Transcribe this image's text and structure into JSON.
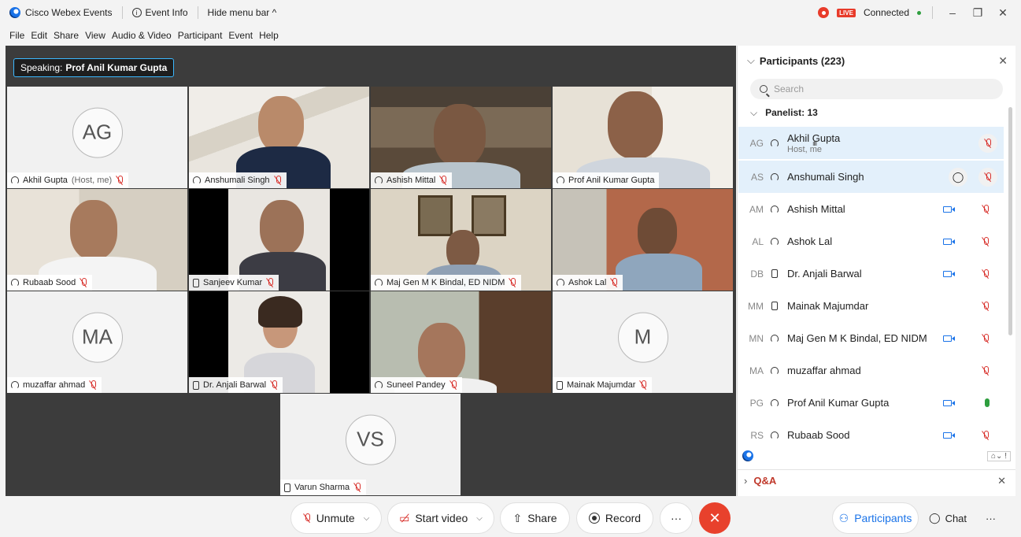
{
  "titlebar": {
    "app_name": "Cisco Webex Events",
    "event_info": "Event Info",
    "hide_menu": "Hide menu bar ^",
    "live": "LIVE",
    "connected": "Connected"
  },
  "menu": [
    "File",
    "Edit",
    "Share",
    "View",
    "Audio & Video",
    "Participant",
    "Event",
    "Help"
  ],
  "speaking": {
    "prefix": "Speaking:",
    "name": "Prof Anil Kumar Gupta"
  },
  "tiles": [
    {
      "name": "Akhil Gupta",
      "sub": "(Host, me)",
      "initials": "AG"
    },
    {
      "name": "Anshumali Singh"
    },
    {
      "name": "Ashish Mittal"
    },
    {
      "name": "Prof Anil Kumar Gupta"
    },
    {
      "name": "Rubaab Sood"
    },
    {
      "name": "Sanjeev Kumar"
    },
    {
      "name": "Maj Gen M K Bindal, ED NIDM"
    },
    {
      "name": "Ashok Lal"
    },
    {
      "name": "muzaffar ahmad",
      "initials": "MA"
    },
    {
      "name": "Dr. Anjali Barwal"
    },
    {
      "name": "Suneel Pandey"
    },
    {
      "name": "Mainak Majumdar",
      "initials": "M"
    },
    {
      "name": "Varun Sharma",
      "initials": "VS"
    }
  ],
  "controls": {
    "unmute": "Unmute",
    "start_video": "Start video",
    "share": "Share",
    "record": "Record",
    "more": "···",
    "participants": "Participants",
    "chat": "Chat"
  },
  "panel": {
    "title": "Participants (223)",
    "search_placeholder": "Search",
    "group": "Panelist: 13",
    "qa": "Q&A",
    "rows": [
      {
        "ini": "AG",
        "name": "Akhil Gupta",
        "role": "Host, me"
      },
      {
        "ini": "AS",
        "name": "Anshumali Singh"
      },
      {
        "ini": "AM",
        "name": "Ashish Mittal"
      },
      {
        "ini": "AL",
        "name": "Ashok Lal"
      },
      {
        "ini": "DB",
        "name": "Dr. Anjali Barwal"
      },
      {
        "ini": "MM",
        "name": "Mainak Majumdar"
      },
      {
        "ini": "MN",
        "name": "Maj Gen M K Bindal, ED NIDM"
      },
      {
        "ini": "MA",
        "name": "muzaffar ahmad"
      },
      {
        "ini": "PG",
        "name": "Prof Anil Kumar Gupta"
      },
      {
        "ini": "RS",
        "name": "Rubaab Sood"
      }
    ]
  }
}
